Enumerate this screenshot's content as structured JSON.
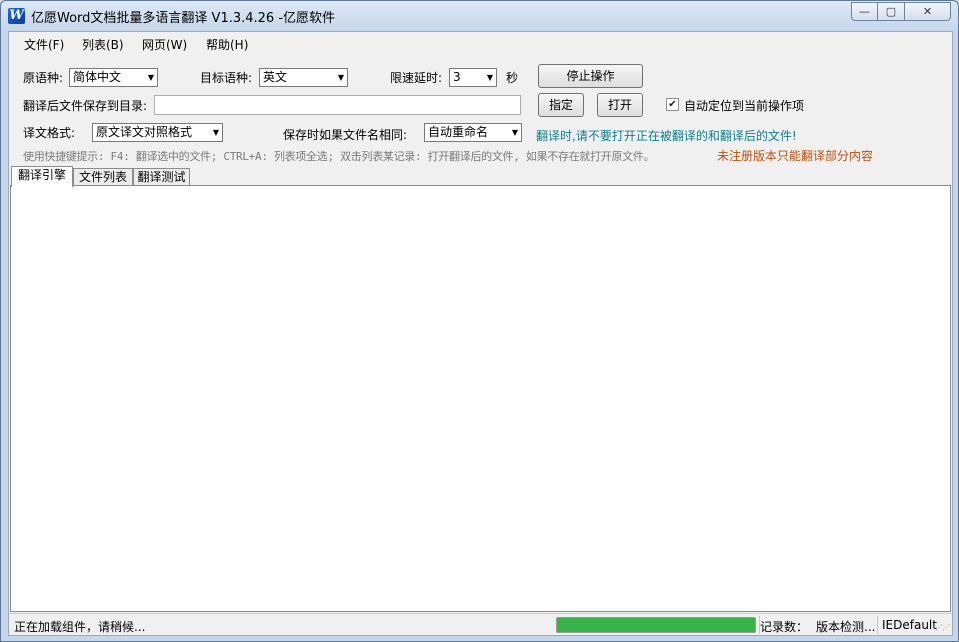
{
  "window": {
    "title": "亿愿Word文档批量多语言翻译 V1.3.4.26 -亿愿软件",
    "app_icon_glyph": "W"
  },
  "titlebar_buttons": {
    "minimize": "—",
    "maximize": "▢",
    "close": "✕"
  },
  "menu": [
    "文件(F)",
    "列表(B)",
    "网页(W)",
    "帮助(H)"
  ],
  "form": {
    "source_lang_label": "原语种:",
    "source_lang_value": "简体中文",
    "target_lang_label": "目标语种:",
    "target_lang_value": "英文",
    "delay_label": "限速延时:",
    "delay_value": "3",
    "delay_unit": "秒",
    "stop_button": "停止操作",
    "save_dir_label": "翻译后文件保存到目录:",
    "save_dir_value": "",
    "assign_button": "指定",
    "open_button": "打开",
    "auto_locate_label": "自动定位到当前操作项",
    "auto_locate_checked": true,
    "format_label": "译文格式:",
    "format_value": "原文译文对照格式",
    "same_name_label": "保存时如果文件名相同:",
    "same_name_value": "自动重命名",
    "warning_teal": "翻译时,请不要打开正在被翻译的和翻译后的文件!",
    "hint": "使用快捷键提示: F4: 翻译选中的文件; CTRL+A: 列表项全选; 双击列表某记录: 打开翻译后的文件, 如果不存在就打开原文件。",
    "warning_orange": "未注册版本只能翻译部分内容"
  },
  "tabs": [
    "翻译引擎",
    "文件列表",
    "翻译测试"
  ],
  "active_tab": 0,
  "status": {
    "loading": "正在加载组件，请稍候...",
    "progress": 1.0,
    "records_label": "记录数：",
    "version_check": "版本检测...",
    "browser": "IEDefault"
  },
  "colors": {
    "teal_text": "#0f7f8a",
    "orange_text": "#c0500a",
    "progress": "#37b34a"
  }
}
